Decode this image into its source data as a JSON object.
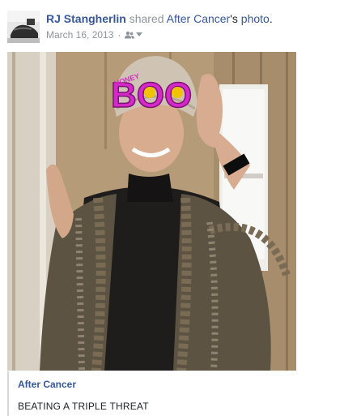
{
  "post": {
    "author": "RJ Stangherlin",
    "action_text": "shared",
    "source_name": "After Cancer",
    "source_suffix": "'s",
    "object": "photo",
    "period": ".",
    "date": "March 16, 2013",
    "separator": "·",
    "audience_icon": "friends-icon",
    "audience_caret": "chevron-down-icon"
  },
  "photo": {
    "glasses_text": "BOO",
    "glasses_small_text": "HONEY"
  },
  "attachment": {
    "source_name": "After Cancer",
    "title": "BEATING A TRIPLE THREAT"
  },
  "colors": {
    "link": "#365899",
    "muted": "#90949c",
    "text": "#1d2129",
    "glasses": "#d629c9"
  }
}
